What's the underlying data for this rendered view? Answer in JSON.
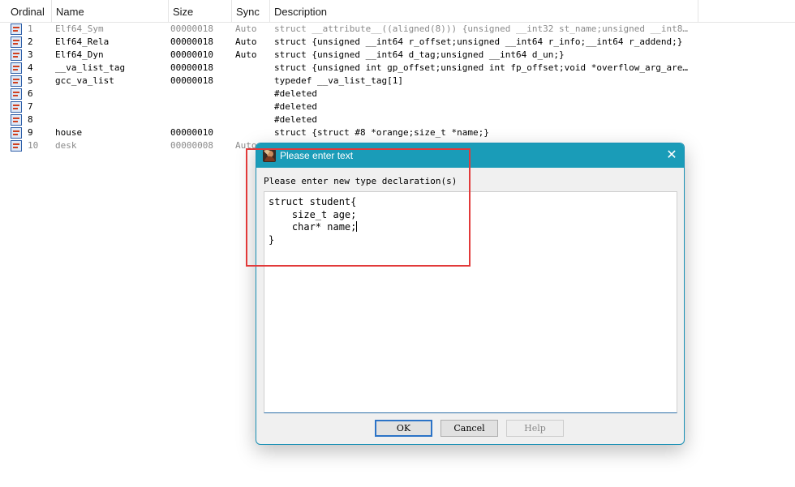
{
  "table": {
    "columns": [
      "Ordinal",
      "Name",
      "Size",
      "Sync",
      "Description"
    ],
    "rows": [
      {
        "ordinal": "1",
        "name": "Elf64_Sym",
        "size": "00000018",
        "sync": "Auto",
        "description": "struct __attribute__((aligned(8))) {unsigned __int32 st_name;unsigned __int8 st_info…",
        "dim": true
      },
      {
        "ordinal": "2",
        "name": "Elf64_Rela",
        "size": "00000018",
        "sync": "Auto",
        "description": "struct {unsigned __int64 r_offset;unsigned __int64 r_info;__int64 r_addend;}",
        "dim": false
      },
      {
        "ordinal": "3",
        "name": "Elf64_Dyn",
        "size": "00000010",
        "sync": "Auto",
        "description": "struct {unsigned __int64 d_tag;unsigned __int64 d_un;}",
        "dim": false
      },
      {
        "ordinal": "4",
        "name": "__va_list_tag",
        "size": "00000018",
        "sync": "",
        "description": "struct {unsigned int gp_offset;unsigned int fp_offset;void *overflow_arg_area;void *…",
        "dim": false
      },
      {
        "ordinal": "5",
        "name": "gcc_va_list",
        "size": "00000018",
        "sync": "",
        "description": "typedef __va_list_tag[1]",
        "dim": false
      },
      {
        "ordinal": "6",
        "name": "",
        "size": "",
        "sync": "",
        "description": "#deleted",
        "dim": false
      },
      {
        "ordinal": "7",
        "name": "",
        "size": "",
        "sync": "",
        "description": "#deleted",
        "dim": false
      },
      {
        "ordinal": "8",
        "name": "",
        "size": "",
        "sync": "",
        "description": "#deleted",
        "dim": false
      },
      {
        "ordinal": "9",
        "name": "house",
        "size": "00000010",
        "sync": "",
        "description": "struct {struct #8 *orange;size_t *name;}",
        "dim": false
      },
      {
        "ordinal": "10",
        "name": "desk",
        "size": "00000008",
        "sync": "Auto",
        "description": "",
        "dim": true
      }
    ]
  },
  "dialog": {
    "title": "Please enter text",
    "prompt": "Please enter new type declaration(s)",
    "text": "struct student{\n    size_t age;\n    char* name;",
    "text_end": "\n}",
    "ok_label": "OK",
    "cancel_label": "Cancel",
    "help_label": "Help",
    "close_glyph": "✕"
  },
  "colors": {
    "titlebar": "#1a9cb8",
    "highlight": "#e23a3a"
  }
}
